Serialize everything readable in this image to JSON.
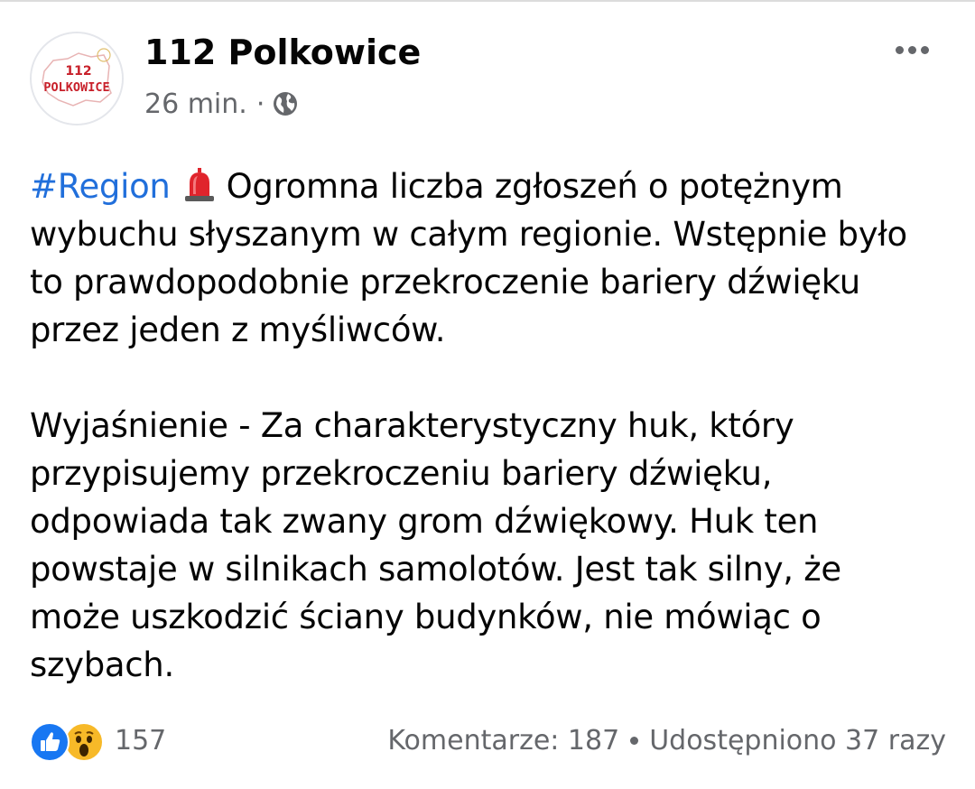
{
  "post": {
    "author": "112 Polkowice",
    "avatar_text": {
      "line1": "112",
      "line2": "POLKOWICE"
    },
    "time": "26 min.",
    "separator": "·",
    "audience_icon": "globe-icon",
    "more_icon": "more-dots-icon",
    "hashtag": "#Region",
    "hashtag_emoji": "police-siren-icon",
    "lines_para1": [
      "Ogromna liczba zgłoszeń o potężnym",
      "wybuchu słyszanym w całym regionie. Wstępnie było",
      "to prawdopodobnie przekroczenie bariery dźwięku",
      "przez jeden z myśliwców."
    ],
    "lines_para2": [
      "Wyjaśnienie - Za charakterystyczny huk, który",
      "przypisujemy przekroczeniu bariery dźwięku,",
      "odpowiada tak zwany grom dźwiękowy. Huk ten",
      "powstaje w silnikach samolotów. Jest tak silny, że",
      "może uszkodzić ściany budynków, nie mówiąc o",
      "szybach."
    ]
  },
  "footer": {
    "reaction_icons": [
      "like-icon",
      "wow-icon"
    ],
    "reaction_count": "157",
    "comments": "Komentarze: 187",
    "shares": "Udostępniono 37 razy"
  },
  "colors": {
    "link": "#216fdb",
    "secondary_text": "#65676b",
    "like_blue": "#1877f2",
    "wow_yellow": "#f7b928",
    "logo_red": "#c8202a"
  }
}
